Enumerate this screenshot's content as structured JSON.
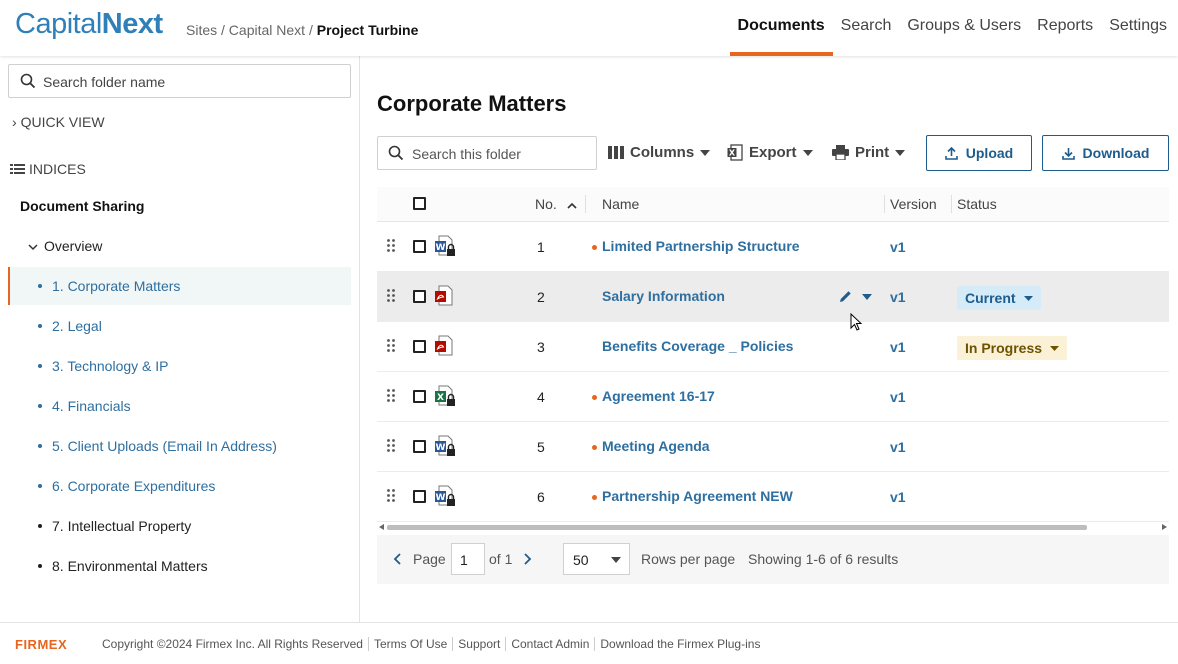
{
  "header": {
    "logo_part1": "Capital",
    "logo_part2": "Next",
    "breadcrumb_1": "Sites",
    "breadcrumb_2": "Capital Next",
    "breadcrumb_current": "Project Turbine",
    "sep": "/",
    "nav": [
      "Documents",
      "Search",
      "Groups & Users",
      "Reports",
      "Settings"
    ],
    "active_nav": "Documents"
  },
  "sidebar": {
    "search_placeholder": "Search folder name",
    "quick_view": "QUICK VIEW",
    "indices": "INDICES",
    "section": "Document Sharing",
    "overview": "Overview",
    "folders": [
      "1. Corporate Matters",
      "2. Legal",
      "3. Technology & IP",
      "4. Financials",
      "5. Client Uploads (Email In Address)",
      "6. Corporate Expenditures",
      "7. Intellectual Property",
      "8. Environmental Matters"
    ]
  },
  "main": {
    "title": "Corporate Matters",
    "search_placeholder": "Search this folder",
    "columns_label": "Columns",
    "export_label": "Export",
    "print_label": "Print",
    "upload_label": "Upload",
    "download_label": "Download",
    "headers": {
      "no": "No.",
      "name": "Name",
      "version": "Version",
      "status": "Status"
    },
    "rows": [
      {
        "no": "1",
        "name": "Limited Partnership Structure",
        "version": "v1",
        "status": "",
        "type": "word-locked",
        "new": true
      },
      {
        "no": "2",
        "name": "Salary Information",
        "version": "v1",
        "status": "Current",
        "type": "pdf",
        "new": false
      },
      {
        "no": "3",
        "name": "Benefits Coverage _ Policies",
        "version": "v1",
        "status": "In Progress",
        "type": "pdf",
        "new": false
      },
      {
        "no": "4",
        "name": "Agreement 16-17",
        "version": "v1",
        "status": "",
        "type": "excel-locked",
        "new": true
      },
      {
        "no": "5",
        "name": "Meeting Agenda",
        "version": "v1",
        "status": "",
        "type": "word-locked",
        "new": true
      },
      {
        "no": "6",
        "name": "Partnership Agreement NEW",
        "version": "v1",
        "status": "",
        "type": "word-locked",
        "new": true
      }
    ],
    "pager": {
      "page_label": "Page",
      "page_value": "1",
      "of_label": "of 1",
      "rows_per_page_value": "50",
      "rows_per_page_label": "Rows per page",
      "showing": "Showing 1-6 of 6 results"
    }
  },
  "footer": {
    "logo": "FIRMEX",
    "links": [
      "Copyright ©2024 Firmex Inc. All Rights Reserved",
      "Terms Of Use",
      "Support",
      "Contact Admin",
      "Download the Firmex Plug-ins"
    ]
  },
  "colors": {
    "accent": "#e8651f",
    "link": "#2e6fa0",
    "brand": "#2f7fb9",
    "button": "#1d5c8d"
  }
}
